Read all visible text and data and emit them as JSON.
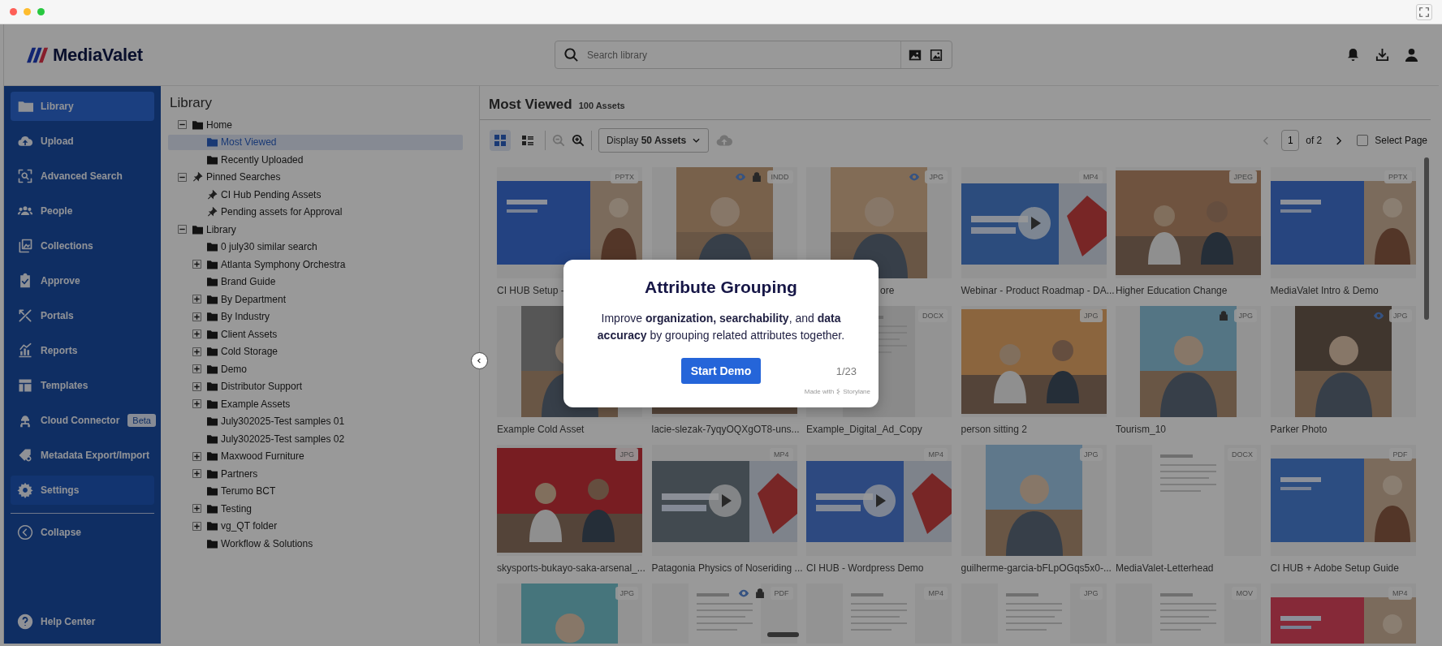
{
  "browser": {
    "lights": [
      {
        "color": "#fe5f57"
      },
      {
        "color": "#febc2e"
      },
      {
        "color": "#28c840"
      }
    ]
  },
  "header": {
    "logo": "MediaValet",
    "search": {
      "placeholder": "Search library"
    }
  },
  "sidebar": {
    "items": [
      {
        "label": "Library",
        "selected": true,
        "hovered": false
      },
      {
        "label": "Upload",
        "selected": false,
        "hovered": false
      },
      {
        "label": "Advanced Search",
        "selected": false,
        "hovered": false
      },
      {
        "label": "People",
        "selected": false,
        "hovered": false
      },
      {
        "label": "Collections",
        "selected": false,
        "hovered": false
      },
      {
        "label": "Approve",
        "selected": false,
        "hovered": false
      },
      {
        "label": "Portals",
        "selected": false,
        "hovered": false
      },
      {
        "label": "Reports",
        "selected": false,
        "hovered": false
      },
      {
        "label": "Templates",
        "selected": false,
        "hovered": false
      },
      {
        "label": "Cloud Connector",
        "badge": "Beta",
        "selected": false,
        "hovered": false
      },
      {
        "label": "Metadata Export/Import",
        "selected": false,
        "hovered": false
      },
      {
        "label": "Settings",
        "selected": false,
        "hovered": true
      }
    ],
    "collapse": "Collapse",
    "help": "Help Center"
  },
  "tree": {
    "title": "Library",
    "items": [
      {
        "label": "Home",
        "kind": "folder",
        "expanded": true,
        "selected": false,
        "children": [
          {
            "label": "Most Viewed",
            "kind": "folder",
            "selected": true
          },
          {
            "label": "Recently Uploaded",
            "kind": "folder",
            "selected": false
          }
        ]
      },
      {
        "label": "Pinned Searches",
        "kind": "pin",
        "expanded": true,
        "selected": false,
        "children": [
          {
            "label": "CI Hub Pending Assets",
            "kind": "pin",
            "selected": false
          },
          {
            "label": "Pending assets for Approval",
            "kind": "pin",
            "selected": false
          }
        ]
      },
      {
        "label": "Library",
        "kind": "folder",
        "expanded": true,
        "selected": false,
        "children": [
          {
            "label": "0 july30 similar search",
            "kind": "folder",
            "selected": false
          },
          {
            "label": "Atlanta Symphony Orchestra",
            "kind": "folder",
            "expanded": false,
            "selected": false
          },
          {
            "label": "Brand Guide",
            "kind": "folder",
            "selected": false
          },
          {
            "label": "By Department",
            "kind": "folder",
            "expanded": false,
            "selected": false
          },
          {
            "label": "By Industry",
            "kind": "folder",
            "expanded": false,
            "selected": false
          },
          {
            "label": "Client Assets",
            "kind": "folder",
            "expanded": false,
            "selected": false
          },
          {
            "label": "Cold Storage",
            "kind": "folder",
            "expanded": false,
            "selected": false
          },
          {
            "label": "Demo",
            "kind": "folder",
            "expanded": false,
            "selected": false
          },
          {
            "label": "Distributor Support",
            "kind": "folder",
            "expanded": false,
            "selected": false
          },
          {
            "label": "Example Assets",
            "kind": "folder",
            "expanded": false,
            "selected": false
          },
          {
            "label": "July302025-Test samples 01",
            "kind": "folder",
            "selected": false
          },
          {
            "label": "July302025-Test samples 02",
            "kind": "folder",
            "selected": false
          },
          {
            "label": "Maxwood Furniture",
            "kind": "folder",
            "expanded": false,
            "selected": false
          },
          {
            "label": "Partners",
            "kind": "folder",
            "expanded": false,
            "selected": false
          },
          {
            "label": "Terumo BCT",
            "kind": "folder",
            "selected": false
          },
          {
            "label": "Testing",
            "kind": "folder",
            "expanded": false,
            "selected": false
          },
          {
            "label": "vg_QT folder",
            "kind": "folder",
            "expanded": false,
            "selected": false
          },
          {
            "label": "Workflow & Solutions",
            "kind": "folder",
            "selected": false
          }
        ]
      }
    ]
  },
  "main": {
    "title": "Most Viewed",
    "count": "100 Assets",
    "views": [
      {
        "kind": "grid",
        "selected": true
      },
      {
        "kind": "list",
        "selected": false
      }
    ],
    "zoom": [
      {
        "kind": "out",
        "disabled": true
      },
      {
        "kind": "in",
        "disabled": false
      }
    ],
    "display": "Display **50 Assets**",
    "pager": {
      "prev_disabled": true,
      "page": "1",
      "total": "of 2",
      "next_disabled": false
    },
    "select_page": {
      "label": "Select Page",
      "checked": false
    },
    "cards": [
      {
        "kind": "slide",
        "badge": "PPTX",
        "title": "CI HUB Setup -",
        "viewable": false,
        "locked": false
      },
      {
        "kind": "portrait",
        "badge": "INDD",
        "viewable": true,
        "locked": true
      },
      {
        "kind": "portrait",
        "badge": "JPG",
        "title": "ore",
        "cut": true,
        "viewable": true,
        "locked": false
      },
      {
        "kind": "video",
        "badge": "MP4",
        "title": "Webinar - Product Roadmap - DA...",
        "viewable": false,
        "locked": false
      },
      {
        "kind": "landscape",
        "badge": "JPEG",
        "title": "Higher Education Change",
        "viewable": false,
        "locked": false
      },
      {
        "kind": "slide",
        "badge": "PPTX",
        "title": "MediaValet Intro & Demo",
        "viewable": false,
        "locked": false
      },
      {
        "kind": "portrait",
        "title": "Example Cold Asset"
      },
      {
        "kind": "landscape",
        "title": "lacie-slezak-7yqyOQXgOT8-uns..."
      },
      {
        "kind": "doc",
        "badge": "DOCX",
        "title": "Example_Digital_Ad_Copy",
        "viewable": false,
        "locked": false
      },
      {
        "kind": "landscape",
        "badge": "JPG",
        "title": "person sitting 2",
        "viewable": false,
        "locked": false
      },
      {
        "kind": "portrait",
        "badge": "JPG",
        "title": "Tourism_10",
        "viewable": false,
        "locked": true
      },
      {
        "kind": "portrait",
        "badge": "JPG",
        "title": "Parker Photo",
        "viewable": true,
        "locked": false
      },
      {
        "kind": "landscape",
        "badge": "JPG",
        "title": "skysports-bukayo-saka-arsenal_...",
        "viewable": false,
        "locked": false
      },
      {
        "kind": "video",
        "badge": "MP4",
        "title": "Patagonia Physics of Noseriding ...",
        "viewable": false,
        "locked": false
      },
      {
        "kind": "video",
        "badge": "MP4",
        "title": "CI HUB - Wordpress Demo",
        "viewable": false,
        "locked": false
      },
      {
        "kind": "portrait",
        "badge": "JPG",
        "title": "guilherme-garcia-bFLpOGqs5x0-...",
        "viewable": false,
        "locked": false
      },
      {
        "kind": "doc",
        "badge": "DOCX",
        "title": "MediaValet-Letterhead",
        "viewable": false,
        "locked": false
      },
      {
        "kind": "slide",
        "badge": "PDF",
        "title": "CI HUB + Adobe Setup Guide",
        "viewable": false,
        "locked": false
      },
      {
        "kind": "portrait",
        "badge": "JPG",
        "viewable": false,
        "locked": false
      },
      {
        "kind": "doc",
        "badge": "PDF",
        "viewable": true,
        "locked": true
      },
      {
        "kind": "doc",
        "badge": "MP4",
        "viewable": false,
        "locked": false
      },
      {
        "kind": "doc",
        "badge": "JPG",
        "viewable": false,
        "locked": false
      },
      {
        "kind": "doc",
        "badge": "MOV",
        "viewable": false,
        "locked": false
      },
      {
        "kind": "slide",
        "badge": "MP4",
        "viewable": false,
        "locked": false
      }
    ]
  },
  "modal": {
    "title": "Attribute Grouping",
    "body": "Improve **organization, searchability**, and **data accuracy** by grouping related attributes together.",
    "button": "Start Demo",
    "counter": "1/23",
    "made_with": "Made with",
    "brand": "Storylane"
  }
}
